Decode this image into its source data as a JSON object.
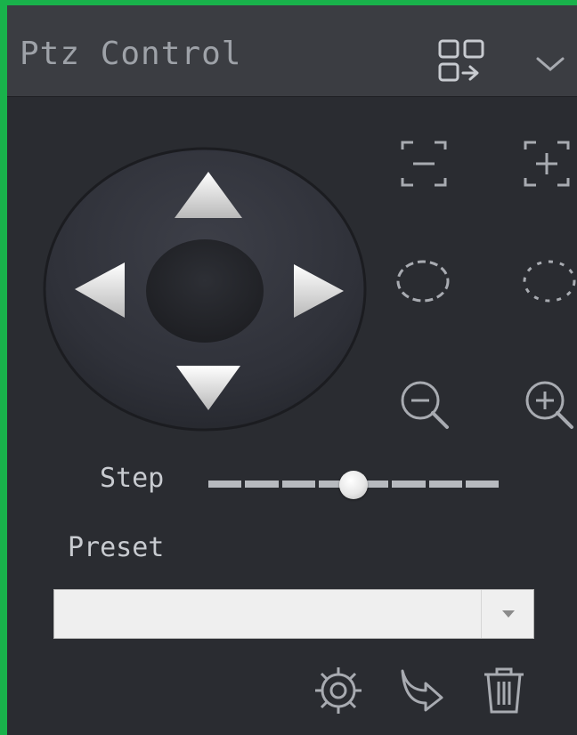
{
  "panel": {
    "title": "Ptz Control",
    "accent_color": "#19b24b",
    "header_icons": [
      "layout-switch-icon",
      "chevron-down-icon"
    ]
  },
  "joystick": {
    "buttons": [
      "arrow-up-icon",
      "arrow-left-icon",
      "arrow-right-icon",
      "arrow-down-icon",
      "center-button"
    ]
  },
  "zoom_controls": [
    "focus-far-icon",
    "focus-near-icon",
    "iris-small-icon",
    "iris-large-icon",
    "zoom-out-icon",
    "zoom-in-icon"
  ],
  "step": {
    "label": "Step",
    "segments": 8,
    "value_fraction": 0.5
  },
  "preset": {
    "label": "Preset",
    "selected_value": ""
  },
  "actions": [
    "gear-icon",
    "goto-preset-icon",
    "trash-icon"
  ]
}
